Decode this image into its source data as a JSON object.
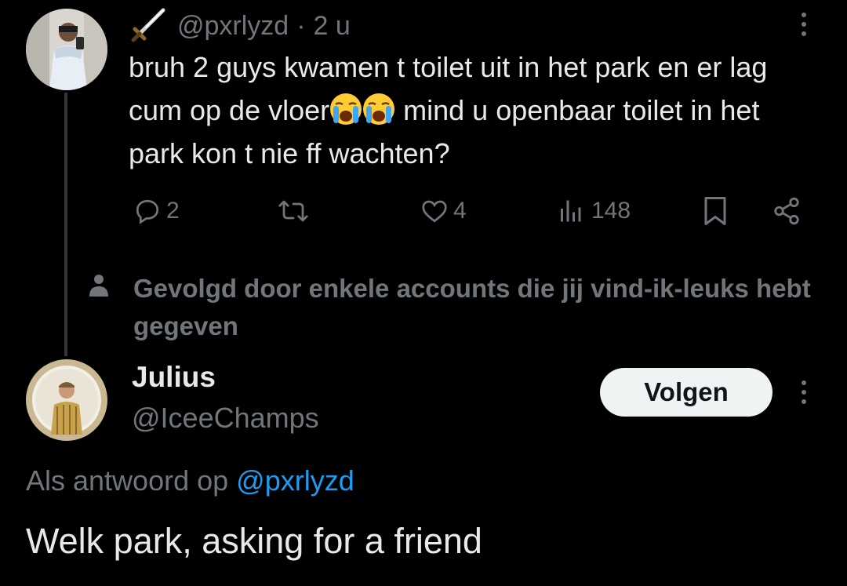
{
  "tweet1": {
    "handle": "@pxrlyzd",
    "separator": "·",
    "time": "2 u",
    "text_part1": "bruh 2 guys kwamen t toilet uit in het park en er lag cum op de vloer",
    "text_part2": " mind u openbaar toilet in het park kon t nie ff wachten?",
    "emoji": "loudly-crying-face-emoji",
    "actions": {
      "replies": "2",
      "retweets": "",
      "likes": "4",
      "views": "148"
    }
  },
  "social_context": {
    "text": "Gevolgd door enkele accounts die jij vind-ik-leuks hebt gegeven"
  },
  "user2": {
    "name": "Julius",
    "handle": "@IceeChamps",
    "follow_label": "Volgen"
  },
  "reply": {
    "prefix": "Als antwoord op ",
    "mention": "@pxrlyzd",
    "text": "Welk park, asking for a friend"
  },
  "colors": {
    "background": "#000000",
    "primary_text": "#e7e9ea",
    "secondary_text": "#71767b",
    "link": "#1d9bf0",
    "follow_button_bg": "#eff3f4"
  }
}
